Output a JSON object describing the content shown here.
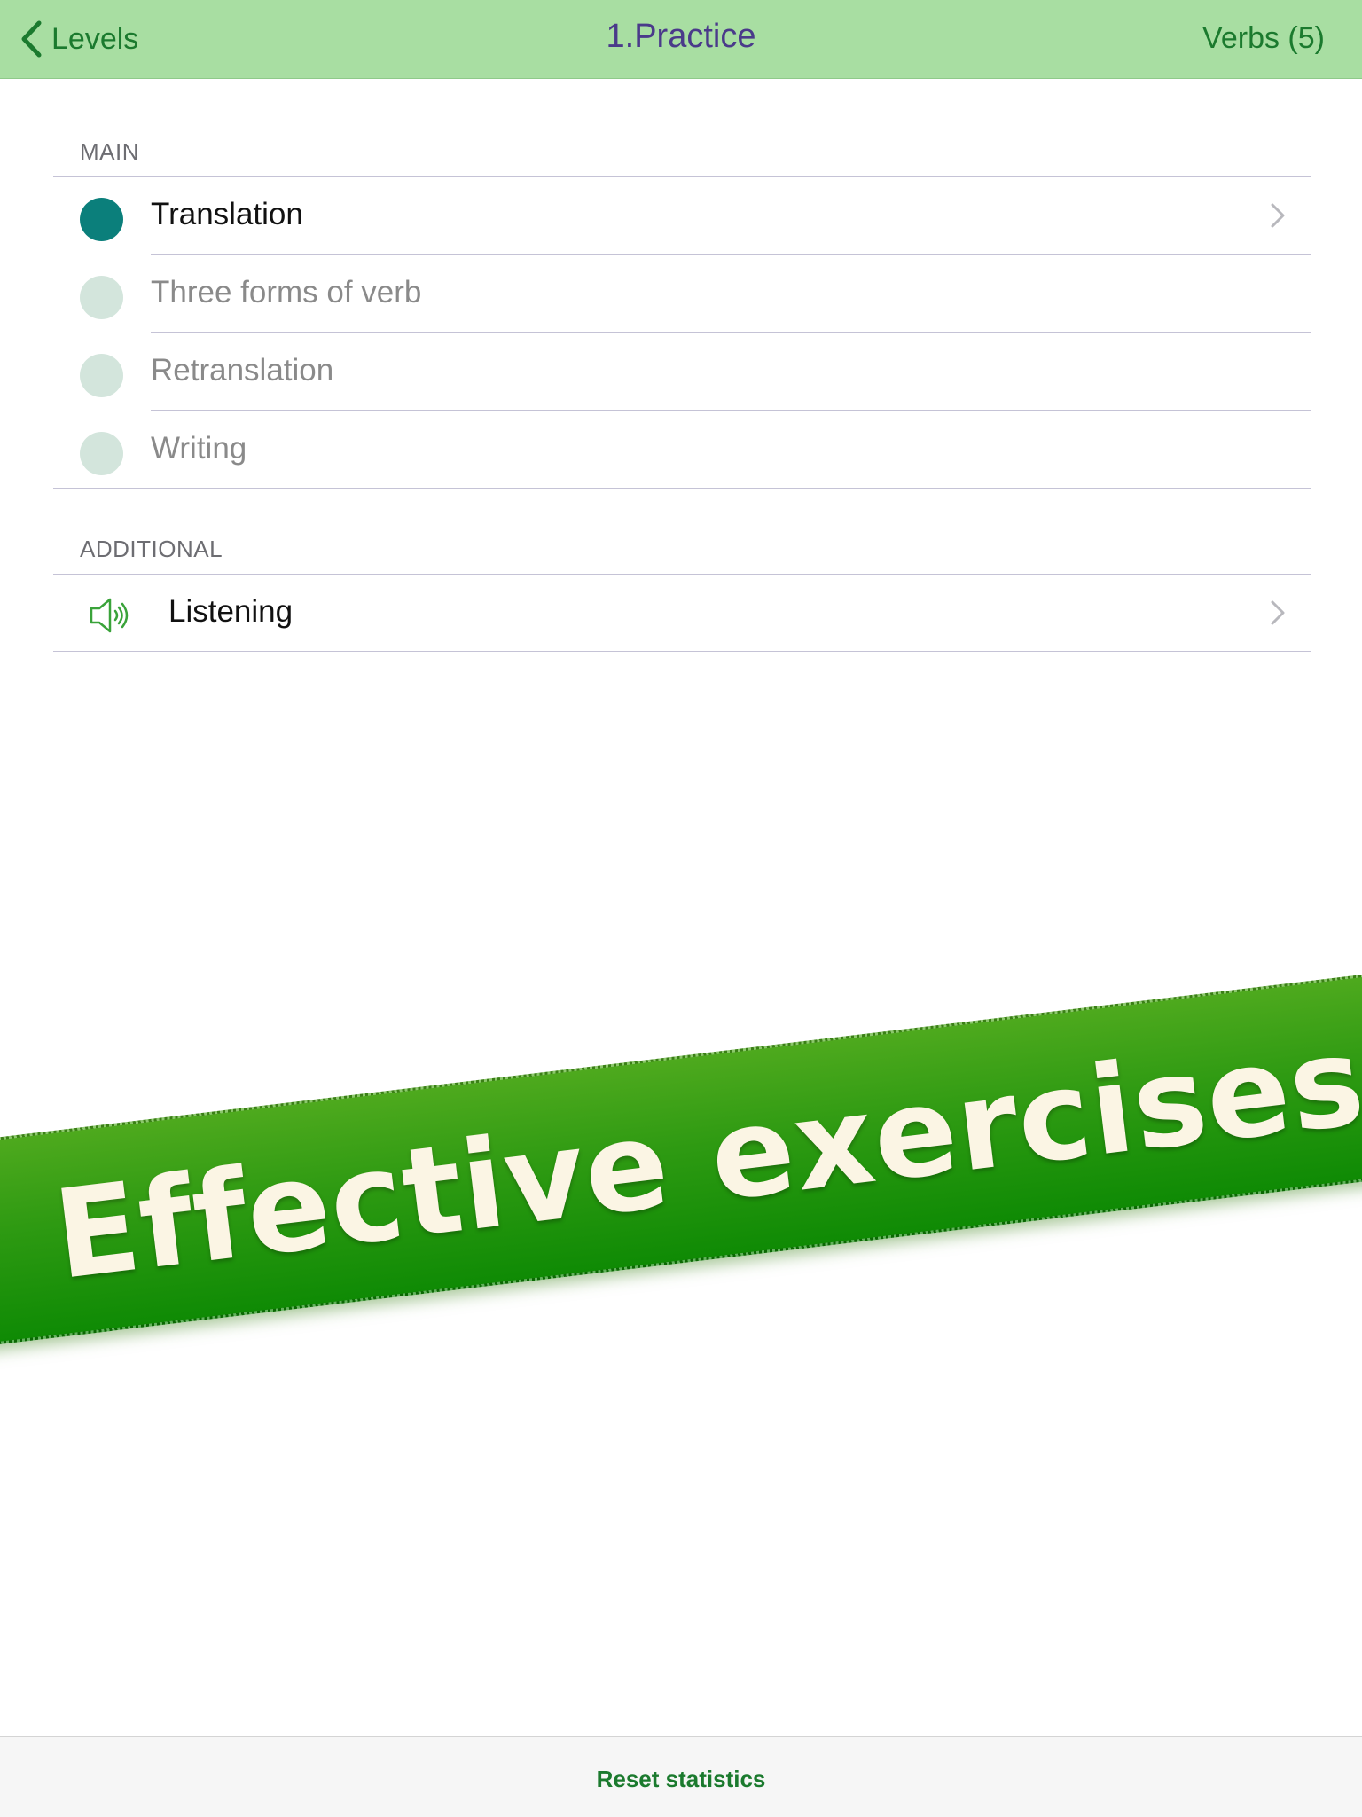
{
  "navbar": {
    "back_label": "Levels",
    "title": "1.Practice",
    "right_label": "Verbs (5)"
  },
  "sections": {
    "main": {
      "header": "MAIN",
      "items": [
        {
          "label": "Translation",
          "status": "active"
        },
        {
          "label": "Three forms of verb",
          "status": "inactive"
        },
        {
          "label": "Retranslation",
          "status": "inactive"
        },
        {
          "label": "Writing",
          "status": "inactive"
        }
      ]
    },
    "additional": {
      "header": "ADDITIONAL",
      "items": [
        {
          "label": "Listening",
          "icon": "speaker-icon"
        }
      ]
    }
  },
  "banner": {
    "text": "Effective exercises"
  },
  "toolbar": {
    "reset_label": "Reset statistics"
  },
  "colors": {
    "navbar_bg": "#a8dea2",
    "accent_green": "#1b7a2e",
    "title_purple": "#4a3a8a",
    "active_dot": "#0b7f7b",
    "inactive_dot": "#d3e5dc",
    "banner_green": "#2e9a12",
    "banner_text": "#fbf5e4"
  }
}
